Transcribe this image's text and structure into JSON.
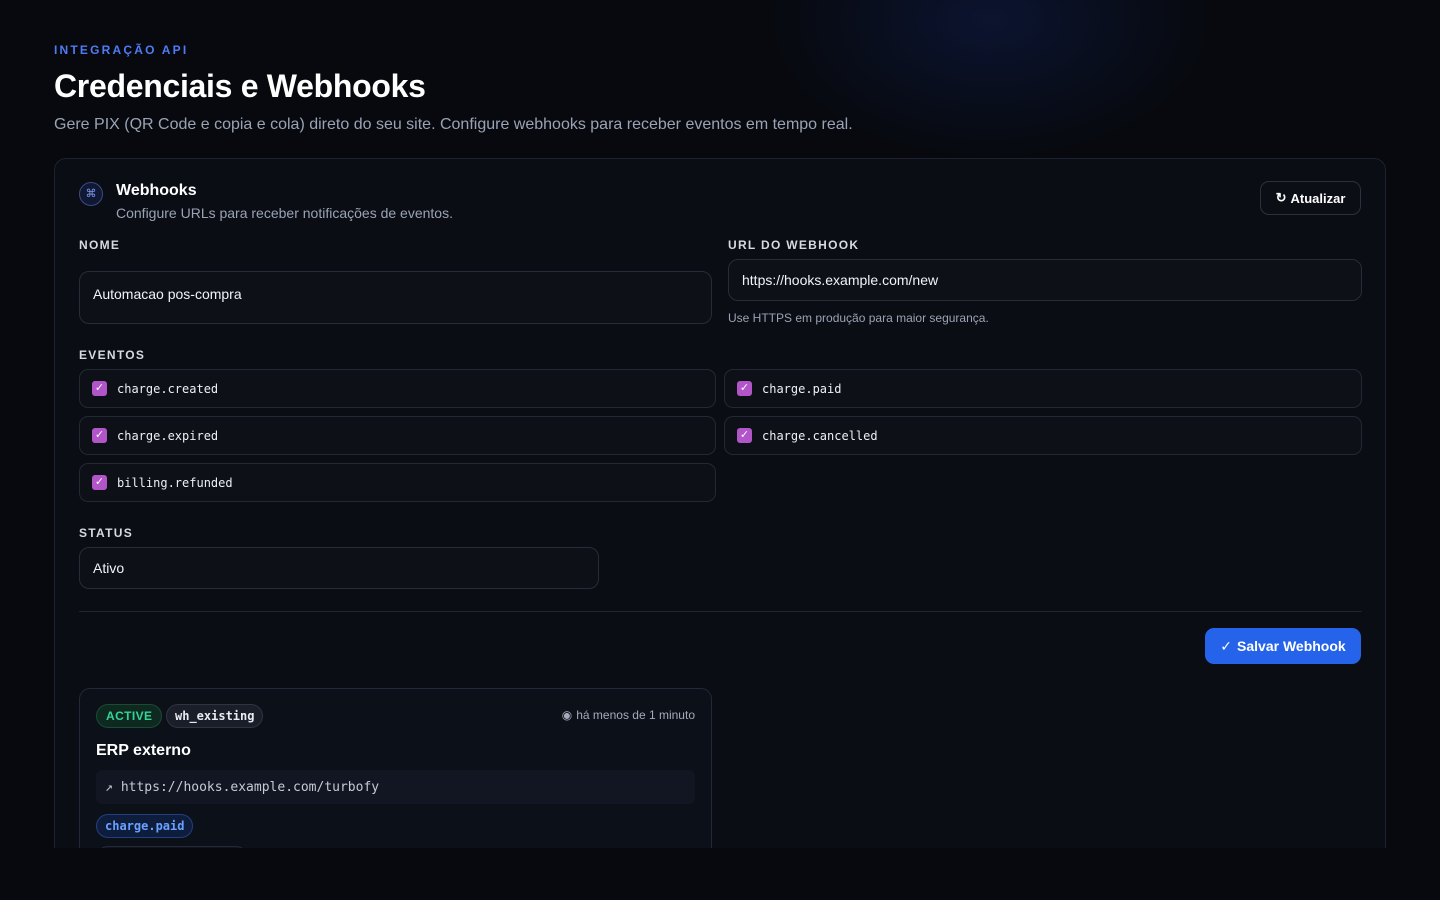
{
  "header": {
    "eyebrow": "INTEGRAÇÃO API",
    "title": "Credenciais e Webhooks",
    "subtitle": "Gere PIX (QR Code e copia e cola) direto do seu site. Configure webhooks para receber eventos em tempo real."
  },
  "card": {
    "icon": "command-icon",
    "title": "Webhooks",
    "subtitle": "Configure URLs para receber notificações de eventos.",
    "refresh_label": "Atualizar"
  },
  "form": {
    "name_label": "NOME",
    "name_value": "Automacao pos-compra",
    "url_label": "URL DO WEBHOOK",
    "url_value": "https://hooks.example.com/new",
    "url_hint": "Use HTTPS em produção para maior segurança.",
    "events_label": "EVENTOS",
    "events": [
      {
        "name": "charge.created",
        "checked": true
      },
      {
        "name": "charge.paid",
        "checked": true
      },
      {
        "name": "charge.expired",
        "checked": true
      },
      {
        "name": "charge.cancelled",
        "checked": true
      },
      {
        "name": "billing.refunded",
        "checked": true
      }
    ],
    "status_label": "STATUS",
    "status_value": "Ativo",
    "save_label": "Salvar Webhook"
  },
  "webhooks": [
    {
      "status": "ACTIVE",
      "id": "wh_existing",
      "time": "há menos de 1 minuto",
      "name": "ERP externo",
      "url": "https://hooks.example.com/turbofy",
      "events": [
        "charge.paid"
      ]
    }
  ],
  "colors": {
    "accent": "#2563eb",
    "eyebrow": "#4f7cf5",
    "checkbox": "#b155c8",
    "active": "#34d399"
  }
}
